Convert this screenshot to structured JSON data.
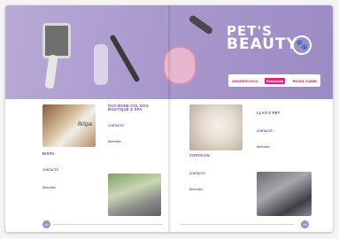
{
  "header": {
    "title_line1": "PET'S",
    "title_line2": "BEAUTY",
    "paw_glyph": "🐾"
  },
  "sponsors": [
    {
      "name": "ANUARIO 2023"
    },
    {
      "name": "Eukanuba"
    },
    {
      "name": "ROYAL CANIN"
    }
  ],
  "photo_labels": {
    "bispa": "BiSpa"
  },
  "cards": {
    "bispa": {
      "title": "BISPA",
      "contact_label": "CONTACTO",
      "address_label": "Dirección"
    },
    "sao": {
      "title": "SAO BONE COL DOG BOUTIQUE & SPA",
      "contact_label": "CONTACTO",
      "address_label": "Dirección"
    },
    "copocan": {
      "title": "COPOCAN",
      "contact_label": "CONTACTO",
      "address_label": "Dirección"
    },
    "lulus": {
      "title": "LLAO'S PET",
      "contact_label": "CONTACTO",
      "address_label": "Dirección"
    }
  },
  "pages": {
    "left": "48",
    "right": "49"
  },
  "colors": {
    "accent": "#9c8bc4",
    "heading": "#6a4fa3"
  }
}
